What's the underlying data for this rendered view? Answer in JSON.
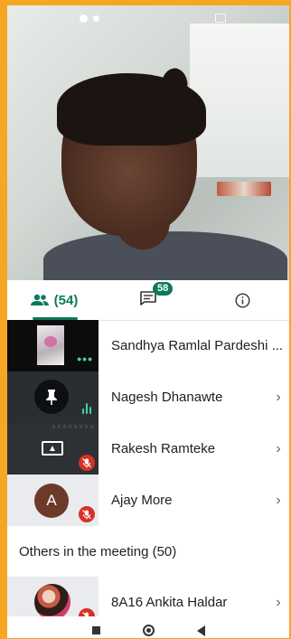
{
  "tabs": {
    "people_label": "(54)",
    "chat_badge": "58"
  },
  "participants": [
    {
      "name": "Sandhya Ramlal Pardeshi ..."
    },
    {
      "name": "Nagesh Dhanawte"
    },
    {
      "name": "Rakesh Ramteke"
    },
    {
      "name": "Ajay More",
      "initial": "A"
    },
    {
      "name": "8A16 Ankita Haldar"
    }
  ],
  "others_header": "Others in the meeting (50)",
  "colors": {
    "accent": "#0b7a5c",
    "muted_red": "#d93025",
    "audio_green": "#46d0a4"
  },
  "icons": {
    "people_tab": "people-icon",
    "chat_tab": "chat-icon",
    "info_tab": "info-icon",
    "pin": "pin-icon",
    "present": "present-screen-icon",
    "mute": "mic-off-icon",
    "more": "more-dots-icon",
    "chevron": "chevron-right-icon"
  }
}
